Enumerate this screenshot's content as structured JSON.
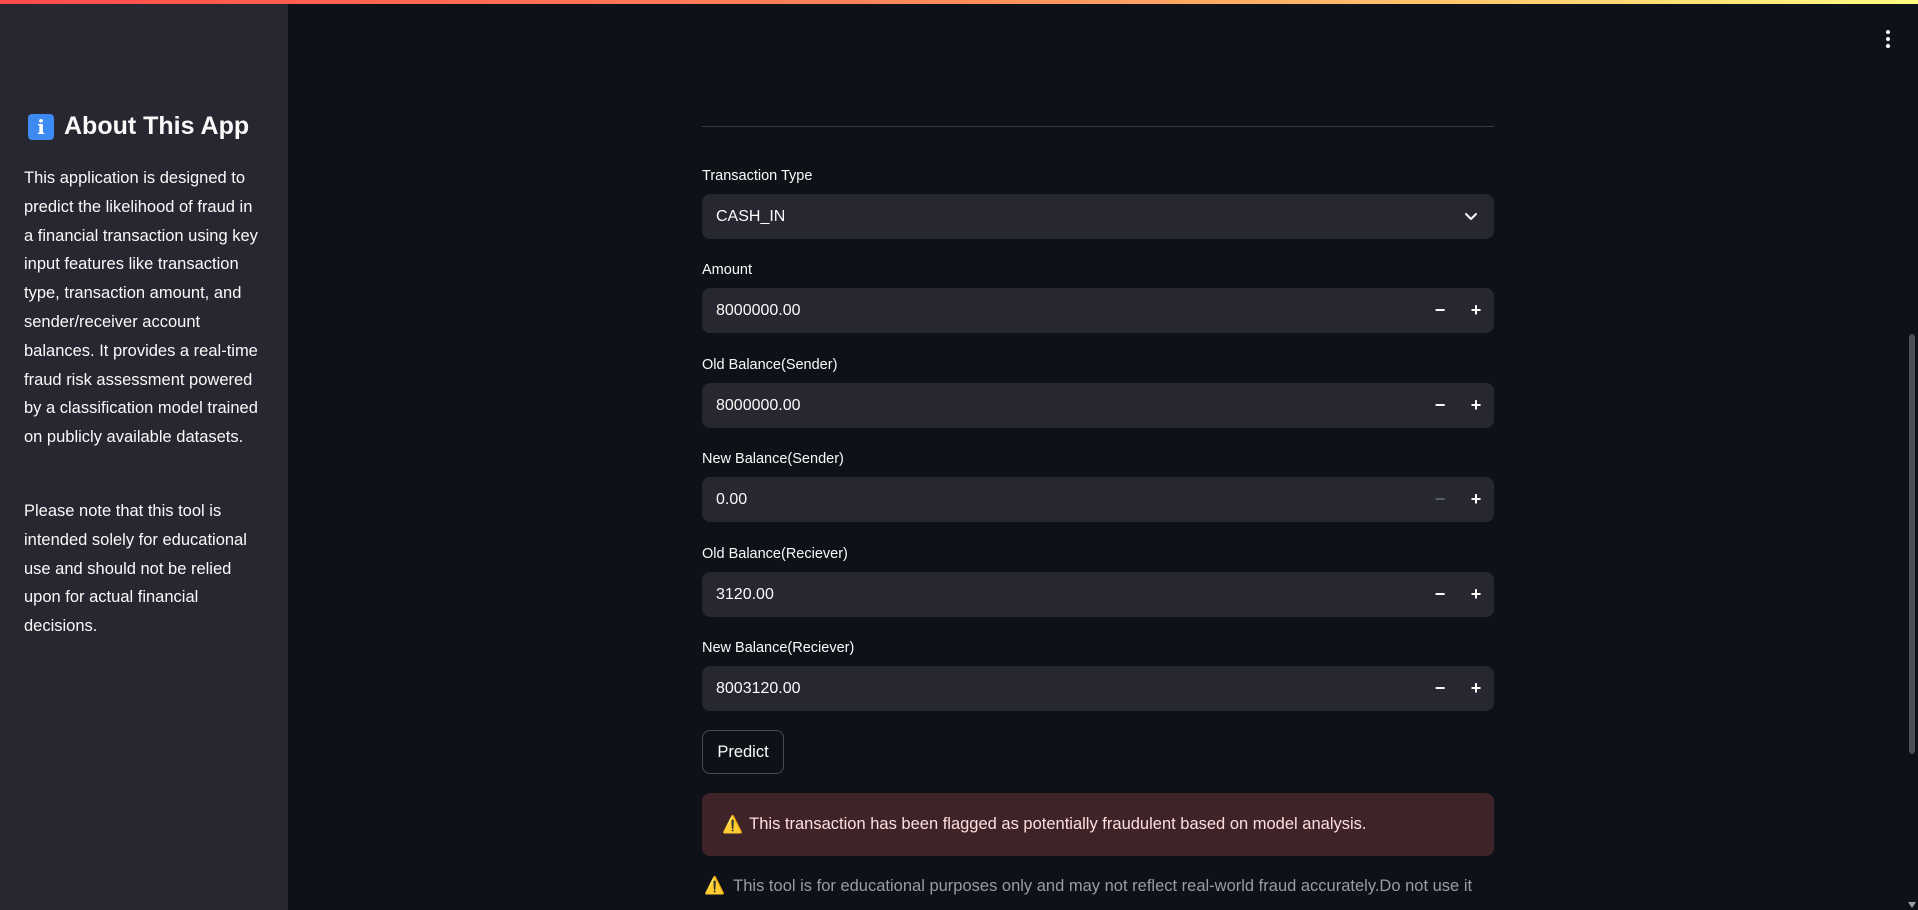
{
  "sidebar": {
    "title": "About This App",
    "info_icon": "i",
    "paragraph_1": "This application is designed to predict the likelihood of fraud in a financial transaction using key input features like transaction type, transaction amount, and sender/receiver account balances. It provides a real-time fraud risk assessment powered by a classification model trained on publicly available datasets.",
    "paragraph_2": "Please note that this tool is intended solely for educational use and should not be relied upon for actual financial decisions."
  },
  "form": {
    "transaction_type": {
      "label": "Transaction Type",
      "value": "CASH_IN"
    },
    "amount": {
      "label": "Amount",
      "value": "8000000.00"
    },
    "old_balance_sender": {
      "label": "Old Balance(Sender)",
      "value": "8000000.00"
    },
    "new_balance_sender": {
      "label": "New Balance(Sender)",
      "value": "0.00"
    },
    "old_balance_receiver": {
      "label": "Old Balance(Reciever)",
      "value": "3120.00"
    },
    "new_balance_receiver": {
      "label": "New Balance(Reciever)",
      "value": "8003120.00"
    },
    "minus": "−",
    "plus": "+"
  },
  "predict_label": "Predict",
  "alert": {
    "icon": "⚠️",
    "text": "This transaction has been flagged as potentially fraudulent based on model analysis."
  },
  "disclaimer": {
    "icon": "⚠️",
    "text": "This tool is for educational purposes only and may not reflect real-world fraud accurately.Do not use it"
  },
  "icons": {
    "menu": "kebab-menu-icon",
    "chevron": "chevron-down-icon",
    "warning": "warning-icon",
    "info": "info-icon"
  },
  "colors": {
    "background": "#0e1117",
    "sidebar": "#262730",
    "input": "#262730",
    "alert_bg": "#3e2428",
    "accent_gradient_start": "#ff4b4b",
    "accent_gradient_end": "#fffd80"
  }
}
